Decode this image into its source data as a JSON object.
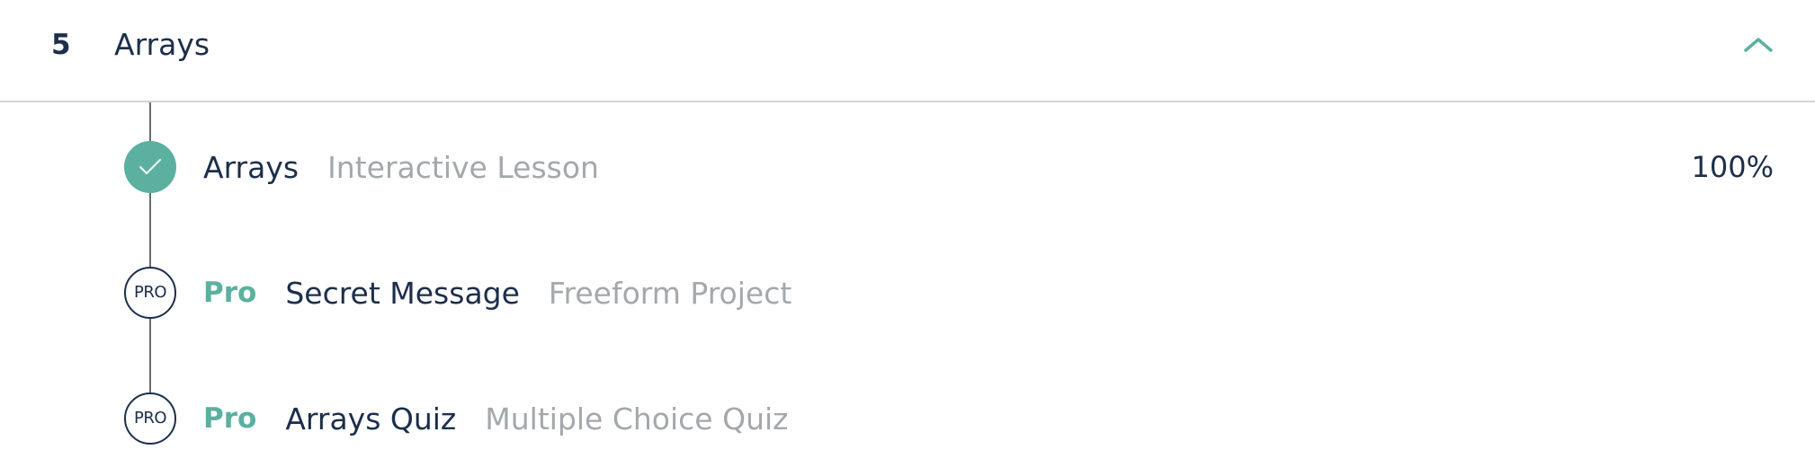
{
  "module": {
    "number": "5",
    "title": "Arrays",
    "toggle_icon": "chevron-up-icon"
  },
  "colors": {
    "accent": "#5cb0a0",
    "text_primary": "#1c2e4a",
    "text_muted": "#a3a8ac",
    "divider": "#cfd4d8"
  },
  "lessons": [
    {
      "status": "complete",
      "status_icon": "checkmark-icon",
      "title": "Arrays",
      "type": "Interactive Lesson",
      "progress": "100%"
    },
    {
      "status": "pro",
      "badge": "PRO",
      "pro_label": "Pro",
      "title": "Secret Message",
      "type": "Freeform Project"
    },
    {
      "status": "pro",
      "badge": "PRO",
      "pro_label": "Pro",
      "title": "Arrays Quiz",
      "type": "Multiple Choice Quiz"
    }
  ]
}
